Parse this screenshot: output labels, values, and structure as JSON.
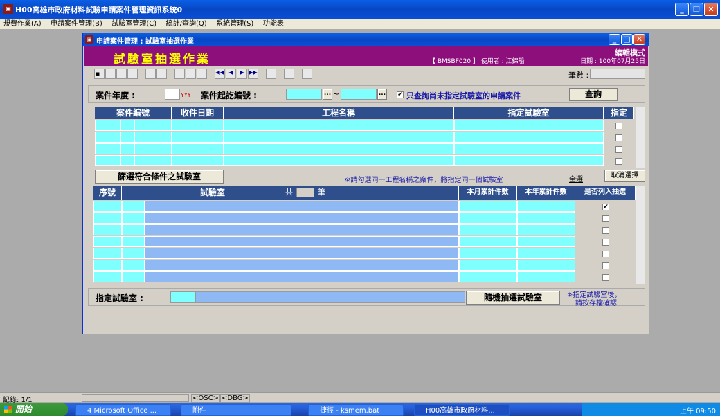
{
  "app": {
    "title": "H00高雄市政府材料試驗申請案件管理資訊系統0",
    "icon": "app-icon"
  },
  "menu": [
    "規費作業(A)",
    "申請案件管理(B)",
    "試驗室管理(C)",
    "統計/查詢(Q)",
    "系統管理(S)",
    "功能表"
  ],
  "window": {
    "title": "申請案件管理 : 試驗室抽選作業"
  },
  "header": {
    "title": "試驗室抽選作業",
    "mode": "編輯模式",
    "info": "【 BMSBF020 】 使用者 : 江錦船",
    "date": "日期 : 100年07月25日"
  },
  "toolbar": {
    "count_label": "筆數 :",
    "count_value": ""
  },
  "query": {
    "year_label": "案件年度 :",
    "year_placeholder": "YYY",
    "year_value": "",
    "start_label": "案件起訖編號 :",
    "from": "",
    "tilde": "~",
    "to": "",
    "ellipsis": "...",
    "only_unassigned": "只查詢尚未指定試驗室的申請案件",
    "only_checked": true,
    "query_btn": "查詢"
  },
  "cases": {
    "headers": [
      "案件編號",
      "收件日期",
      "工程名稱",
      "指定試驗室",
      "指定"
    ],
    "rows": 4,
    "checks": [
      false,
      false,
      false,
      false
    ]
  },
  "filter": {
    "btn": "篩選符合條件之試驗室",
    "note": "※請勾選同一工程名稱之案件，將指定同一個試驗室",
    "select_all": "全選",
    "cancel_all": "取消選擇"
  },
  "labs": {
    "headers": [
      "序號",
      "試驗室",
      "本月累計件數",
      "本年累計件數",
      "是否列入抽選"
    ],
    "total_prefix": "共",
    "total_value": "",
    "total_suffix": "筆",
    "rows": 7,
    "checks": [
      true,
      false,
      false,
      false,
      false,
      false,
      false
    ]
  },
  "assign": {
    "label": "指定試驗室 :",
    "code": "",
    "name": "",
    "random_btn": "隨機抽選試驗室",
    "note1": "※指定試驗室後，",
    "note2": "請按存檔確認"
  },
  "status": {
    "record": "記錄: 1/1",
    "osc": "<OSC>",
    "dbg": "<DBG>"
  },
  "taskbar": {
    "start": "開始",
    "items": [
      "4 Microsoft Office ...",
      "附件",
      "捷徑 - ksmem.bat",
      "H00高雄市政府材料..."
    ],
    "time": "上午 09:50"
  }
}
